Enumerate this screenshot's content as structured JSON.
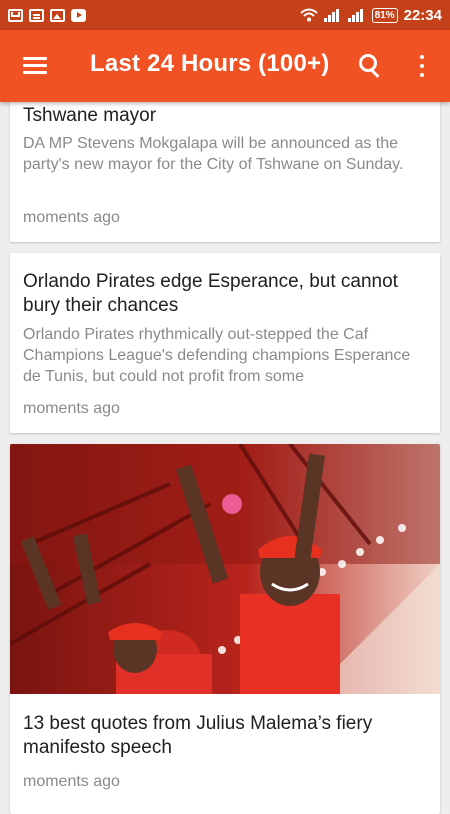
{
  "status_bar": {
    "battery": "81%",
    "time": "22:34"
  },
  "app_bar": {
    "title": "Last 24 Hours (100+)"
  },
  "articles": [
    {
      "title": "Tshwane mayor",
      "description": "DA MP Stevens Mokgalapa will be announced as the party's new mayor for the City of Tshwane on Sunday.",
      "time": "moments ago"
    },
    {
      "title": "Orlando Pirates edge Esperance, but cannot bury their chances",
      "description": "Orlando Pirates rhythmically out-stepped the Caf Champions League's defending champions Esperance de Tunis, but could not profit from some",
      "time": "moments ago"
    },
    {
      "title": "13 best quotes from Julius Malema’s fiery manifesto speech",
      "time": "moments ago"
    }
  ],
  "colors": {
    "status_bar": "#c4411a",
    "app_bar": "#f05224",
    "background": "#eeeeee"
  }
}
